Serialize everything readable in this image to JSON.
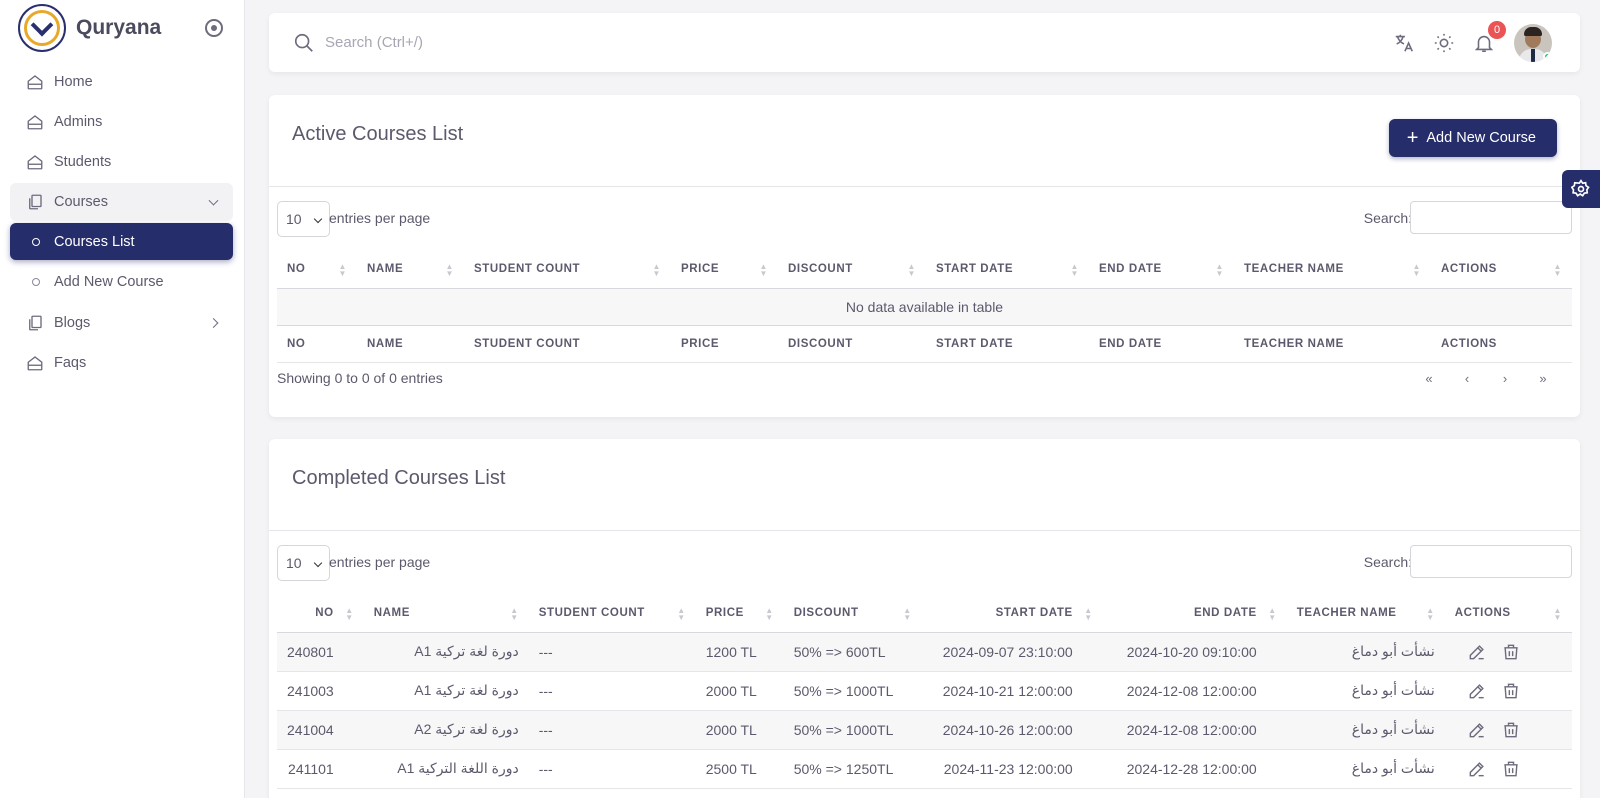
{
  "brand": {
    "name": "Quryana"
  },
  "sidebar": {
    "items": [
      {
        "label": "Home",
        "icon": "home-icon"
      },
      {
        "label": "Admins",
        "icon": "home-icon"
      },
      {
        "label": "Students",
        "icon": "home-icon"
      },
      {
        "label": "Courses",
        "icon": "files-icon",
        "expanded": true,
        "children": [
          {
            "label": "Courses List",
            "active": true
          },
          {
            "label": "Add New Course",
            "active": false
          }
        ]
      },
      {
        "label": "Blogs",
        "icon": "files-icon"
      },
      {
        "label": "Faqs",
        "icon": "home-icon"
      }
    ]
  },
  "topbar": {
    "search_placeholder": "Search (Ctrl+/)",
    "notification_count": "0"
  },
  "active_courses": {
    "title": "Active Courses List",
    "add_button_label": "Add New Course",
    "length_value": "10",
    "length_label": "entries per page",
    "search_label": "Search:",
    "columns": [
      "NO",
      "NAME",
      "STUDENT COUNT",
      "PRICE",
      "DISCOUNT",
      "START DATE",
      "END DATE",
      "TEACHER NAME",
      "ACTIONS"
    ],
    "empty_text": "No data available in table",
    "info_text": "Showing 0 to 0 of 0 entries",
    "pager": [
      "«",
      "‹",
      "›",
      "»"
    ]
  },
  "completed_courses": {
    "title": "Completed Courses List",
    "length_value": "10",
    "length_label": "entries per page",
    "search_label": "Search:",
    "columns": [
      "NO",
      "NAME",
      "STUDENT COUNT",
      "PRICE",
      "DISCOUNT",
      "START DATE",
      "END DATE",
      "TEACHER NAME",
      "ACTIONS"
    ],
    "rows": [
      {
        "no": "240801",
        "name": "دورة لغة تركية A1",
        "student_count": "---",
        "price": "1200 TL",
        "discount": "50% => 600TL",
        "start": "2024-09-07 23:10:00",
        "end": "2024-10-20 09:10:00",
        "teacher": "نشأت أبو دماغ"
      },
      {
        "no": "241003",
        "name": "دورة لغة تركية A1",
        "student_count": "---",
        "price": "2000 TL",
        "discount": "50% => 1000TL",
        "start": "2024-10-21 12:00:00",
        "end": "2024-12-08 12:00:00",
        "teacher": "نشأت أبو دماغ"
      },
      {
        "no": "241004",
        "name": "دورة لغة تركية A2",
        "student_count": "---",
        "price": "2000 TL",
        "discount": "50% => 1000TL",
        "start": "2024-10-26 12:00:00",
        "end": "2024-12-08 12:00:00",
        "teacher": "نشأت أبو دماغ"
      },
      {
        "no": "241101",
        "name": "دورة اللغة التركية A1",
        "student_count": "---",
        "price": "2500 TL",
        "discount": "50% => 1250TL",
        "start": "2024-11-23 12:00:00",
        "end": "2024-12-28 12:00:00",
        "teacher": "نشأت أبو دماغ"
      }
    ]
  },
  "colors": {
    "primary": "#262d6b",
    "badge": "#ea5455",
    "online": "#28c76f"
  }
}
